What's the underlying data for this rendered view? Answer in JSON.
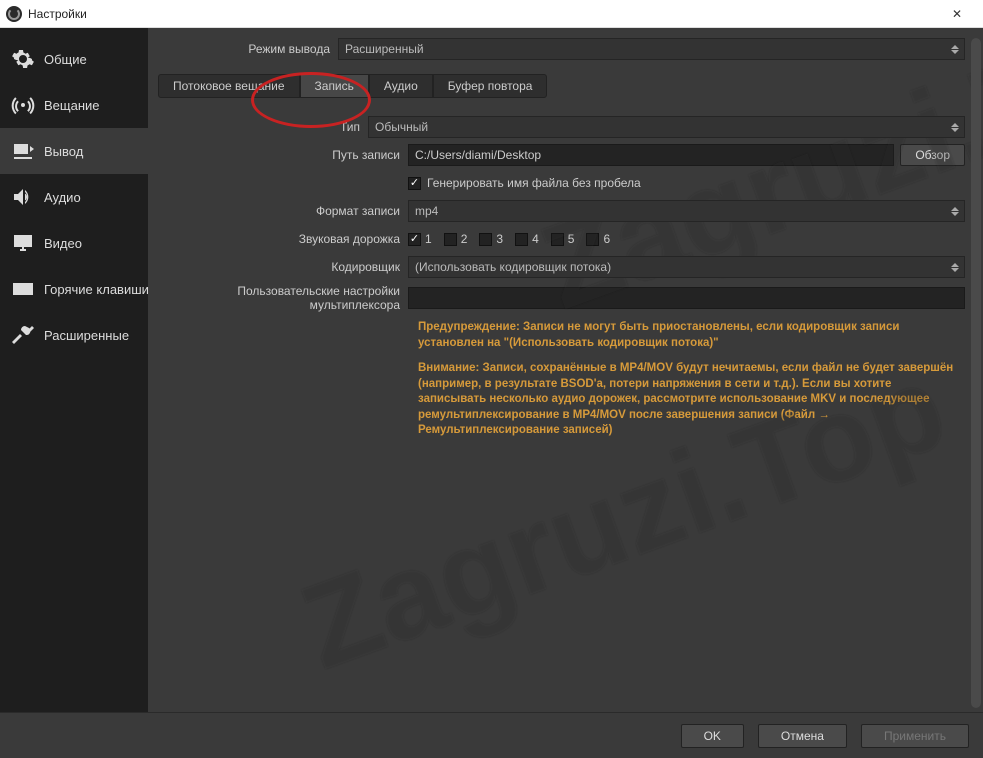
{
  "title": "Настройки",
  "close_glyph": "✕",
  "sidebar": {
    "items": [
      {
        "label": "Общие"
      },
      {
        "label": "Вещание"
      },
      {
        "label": "Вывод"
      },
      {
        "label": "Аудио"
      },
      {
        "label": "Видео"
      },
      {
        "label": "Горячие клавиши"
      },
      {
        "label": "Расширенные"
      }
    ]
  },
  "labels": {
    "mode": "Режим вывода",
    "type": "Тип",
    "path": "Путь записи",
    "gen_name": "Генерировать имя файла без пробела",
    "format": "Формат записи",
    "tracks": "Звуковая дорожка",
    "encoder": "Кодировщик",
    "mux": "Пользовательские настройки мультиплексора"
  },
  "values": {
    "mode": "Расширенный",
    "type": "Обычный",
    "path": "C:/Users/diami/Desktop",
    "format": "mp4",
    "encoder": "(Использовать кодировщик потока)"
  },
  "tabs": [
    "Потоковое вещание",
    "Запись",
    "Аудио",
    "Буфер повтора"
  ],
  "tracks": [
    "1",
    "2",
    "3",
    "4",
    "5",
    "6"
  ],
  "buttons": {
    "browse": "Обзор",
    "ok": "OK",
    "cancel": "Отмена",
    "apply": "Применить"
  },
  "warnings": {
    "w1": "Предупреждение: Записи не могут быть приостановлены, если кодировщик записи установлен на \"(Использовать кодировщик потока)\"",
    "w2": "Внимание: Записи, сохранённые в MP4/MOV будут нечитаемы, если файл не будет завершён (например, в результате BSOD'а, потери напряжения в сети и т.д.). Если вы хотите записывать несколько аудио дорожек, рассмотрите использование MKV и последующее ремультиплексирование в MP4/MOV после завершения записи (Файл → Ремультиплексирование записей)"
  },
  "watermark": "Zagruzi.Top"
}
